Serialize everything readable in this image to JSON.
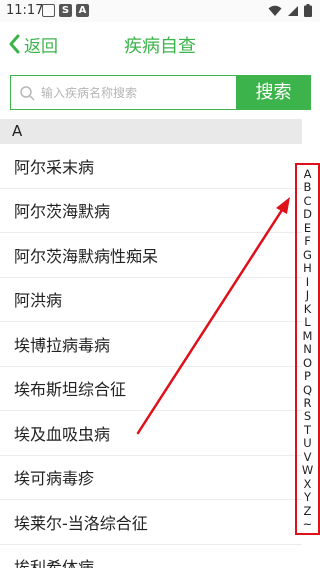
{
  "status_bar": {
    "time": "11:17"
  },
  "nav": {
    "back_label": "返回",
    "title": "疾病自查",
    "accent_color": "#3cb44b"
  },
  "search": {
    "placeholder": "输入疾病名称搜索",
    "button_label": "搜索"
  },
  "section": {
    "header": "A"
  },
  "diseases": [
    "阿尔采末病",
    "阿尔茨海默病",
    "阿尔茨海默病性痴呆",
    "阿洪病",
    "埃博拉病毒病",
    "埃布斯坦综合征",
    "埃及血吸虫病",
    "埃可病毒疹",
    "埃莱尔-当洛综合征",
    "埃利希体病"
  ],
  "index_letters": [
    "A",
    "B",
    "C",
    "D",
    "E",
    "F",
    "G",
    "H",
    "I",
    "J",
    "K",
    "L",
    "M",
    "N",
    "O",
    "P",
    "Q",
    "R",
    "S",
    "T",
    "U",
    "V",
    "W",
    "X",
    "Y",
    "Z",
    "~"
  ],
  "annotation": {
    "highlight_color": "#e0101a"
  }
}
